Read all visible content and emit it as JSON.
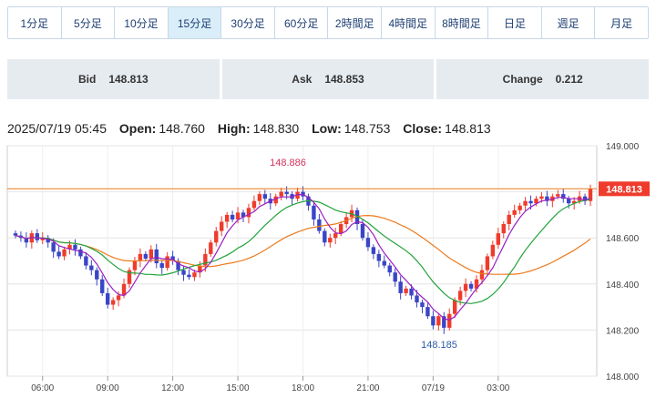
{
  "timeframes": [
    {
      "label": "1分足",
      "active": false
    },
    {
      "label": "5分足",
      "active": false
    },
    {
      "label": "10分足",
      "active": false
    },
    {
      "label": "15分足",
      "active": true
    },
    {
      "label": "30分足",
      "active": false
    },
    {
      "label": "60分足",
      "active": false
    },
    {
      "label": "2時間足",
      "active": false
    },
    {
      "label": "4時間足",
      "active": false
    },
    {
      "label": "8時間足",
      "active": false
    },
    {
      "label": "日足",
      "active": false
    },
    {
      "label": "週足",
      "active": false
    },
    {
      "label": "月足",
      "active": false
    }
  ],
  "quote": {
    "bid_label": "Bid",
    "bid": "148.813",
    "ask_label": "Ask",
    "ask": "148.853",
    "change_label": "Change",
    "change": "0.212"
  },
  "ohlc": {
    "datetime": "2025/07/19 05:45",
    "open_label": "Open:",
    "open": "148.760",
    "high_label": "High:",
    "high": "148.830",
    "low_label": "Low:",
    "low": "148.753",
    "close_label": "Close:",
    "close": "148.813"
  },
  "chart_data": {
    "type": "candlestick",
    "y_ticks": [
      "149.000",
      "148.800",
      "148.600",
      "148.400",
      "148.200",
      "148.000"
    ],
    "ylim": [
      148.0,
      149.0
    ],
    "x_ticks": [
      "06:00",
      "09:00",
      "12:00",
      "15:00",
      "18:00",
      "21:00",
      "07/19",
      "03:00"
    ],
    "current_price": "148.813",
    "max_label": "148.886",
    "min_label": "148.185",
    "colors": {
      "up": "#ef3b2c",
      "down": "#3a45c6",
      "ma_short": "#9b1fc4",
      "ma_mid": "#21a33a",
      "ma_long": "#ec7a1c",
      "price_line": "#ec7a1c"
    },
    "closes": [
      148.61,
      148.6,
      148.58,
      148.62,
      148.59,
      148.6,
      148.58,
      148.54,
      148.52,
      148.55,
      148.57,
      148.55,
      148.52,
      148.48,
      148.46,
      148.42,
      148.36,
      148.31,
      148.33,
      148.35,
      148.4,
      148.46,
      148.5,
      148.53,
      148.51,
      148.55,
      148.49,
      148.47,
      148.52,
      148.5,
      148.46,
      148.44,
      148.43,
      148.45,
      148.48,
      148.53,
      148.58,
      148.63,
      148.67,
      148.7,
      148.68,
      148.71,
      148.69,
      148.73,
      148.76,
      148.79,
      148.77,
      148.75,
      148.78,
      148.8,
      148.79,
      148.77,
      148.8,
      148.78,
      148.74,
      148.68,
      148.63,
      148.58,
      148.6,
      148.62,
      148.66,
      148.69,
      148.72,
      148.66,
      148.6,
      148.56,
      148.53,
      148.5,
      148.48,
      148.45,
      148.41,
      148.36,
      148.38,
      148.35,
      148.32,
      148.3,
      148.26,
      148.22,
      148.26,
      148.21,
      148.27,
      148.33,
      148.37,
      148.4,
      148.38,
      148.42,
      148.46,
      148.52,
      148.57,
      148.62,
      148.66,
      148.7,
      148.72,
      148.74,
      148.76,
      148.75,
      148.77,
      148.78,
      148.76,
      148.78,
      148.79,
      148.77,
      148.75,
      148.76,
      148.78,
      148.76,
      148.813
    ]
  }
}
